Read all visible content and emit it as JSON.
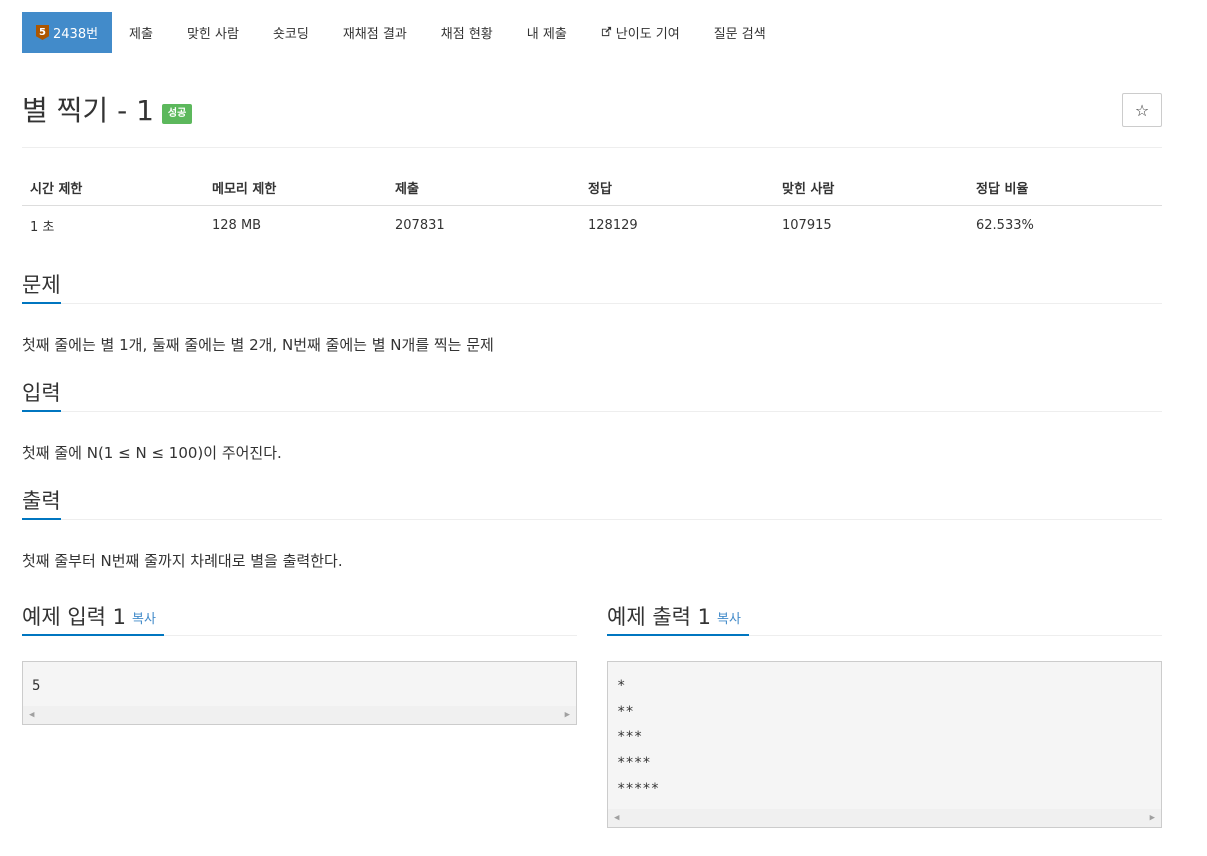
{
  "nav": {
    "problem_tab": {
      "tier": "5",
      "label": "2438번"
    },
    "items": [
      {
        "label": "제출"
      },
      {
        "label": "맞힌 사람"
      },
      {
        "label": "숏코딩"
      },
      {
        "label": "재채점 결과"
      },
      {
        "label": "채점 현황"
      },
      {
        "label": "내 제출"
      },
      {
        "label": "난이도 기여",
        "icon": "external-link-icon"
      },
      {
        "label": "질문 검색"
      }
    ]
  },
  "problem": {
    "title": "별 찍기 - 1",
    "result_badge": "성공",
    "star_button": "☆"
  },
  "info_table": {
    "headers": [
      "시간 제한",
      "메모리 제한",
      "제출",
      "정답",
      "맞힌 사람",
      "정답 비율"
    ],
    "values": [
      "1 초",
      "128 MB",
      "207831",
      "128129",
      "107915",
      "62.533%"
    ]
  },
  "sections": {
    "problem": {
      "title": "문제",
      "body": "첫째 줄에는 별 1개, 둘째 줄에는 별 2개, N번째 줄에는 별 N개를 찍는 문제"
    },
    "input": {
      "title": "입력",
      "body": "첫째 줄에 N(1 ≤ N ≤ 100)이 주어진다."
    },
    "output": {
      "title": "출력",
      "body": "첫째 줄부터 N번째 줄까지 차례대로 별을 출력한다."
    }
  },
  "examples": {
    "input": {
      "title": "예제 입력 1",
      "copy": "복사",
      "content": "5"
    },
    "output": {
      "title": "예제 출력 1",
      "copy": "복사",
      "content": "*\n**\n***\n****\n*****"
    }
  },
  "colors": {
    "primary": "#428bca",
    "success": "#5cb85c",
    "tier_bronze": "#ad5600",
    "underline": "#0076c0"
  }
}
